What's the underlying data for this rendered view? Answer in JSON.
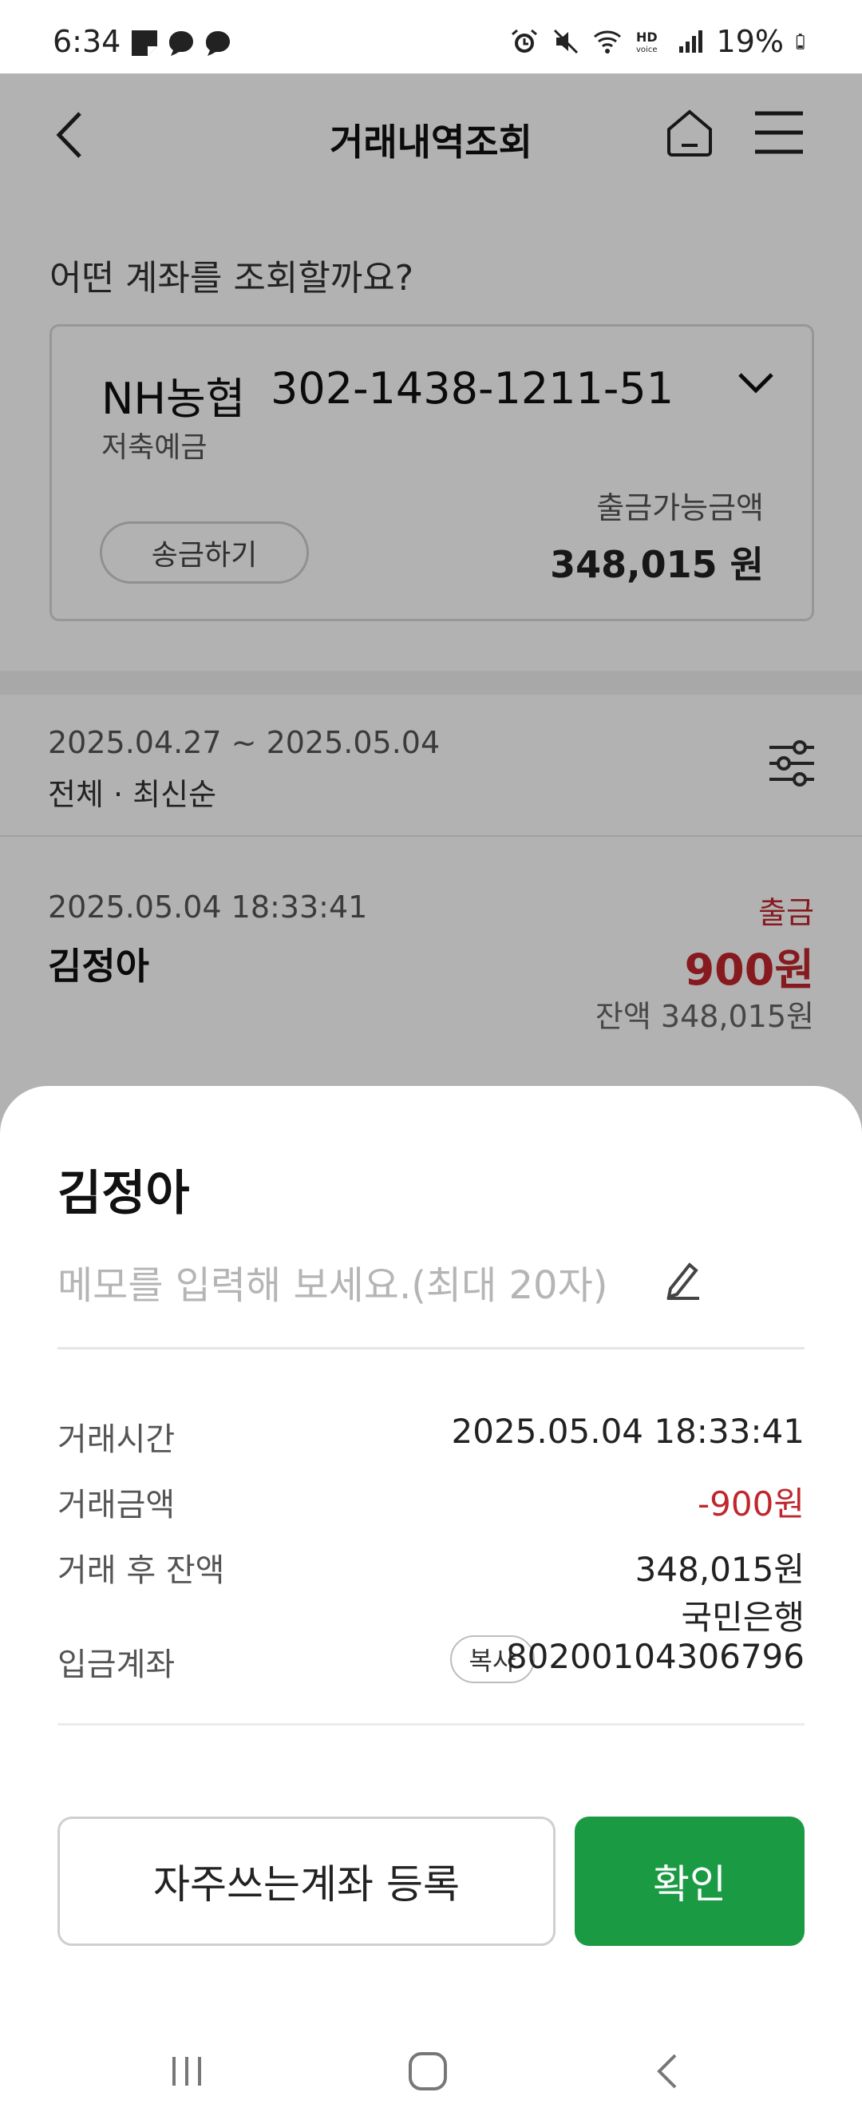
{
  "status_bar": {
    "time": "6:34",
    "battery": "19%",
    "icons": [
      "sticky-note-icon",
      "thread-icon",
      "thread-icon",
      "alarm-icon",
      "mute-icon",
      "wifi-icon",
      "hd-voice-icon",
      "signal-icon",
      "battery-icon"
    ]
  },
  "header": {
    "title": "거래내역조회",
    "icons": [
      "back-icon",
      "home-icon",
      "menu-icon"
    ]
  },
  "account": {
    "question": "어떤 계좌를 조회할까요?",
    "bank": "NH농협",
    "number": "302-1438-1211-51",
    "type": "저축예금",
    "send_label": "송금하기",
    "available_label": "출금가능금액",
    "available_amount": "348,015 원"
  },
  "filter": {
    "range": "2025.04.27 ~ 2025.05.04",
    "description": "전체 · 최신순",
    "icon": "filter-sliders-icon"
  },
  "transaction": {
    "datetime": "2025.05.04 18:33:41",
    "name": "김정아",
    "type": "출금",
    "amount": "900원",
    "balance": "잔액 348,015원"
  },
  "sheet": {
    "name": "김정아",
    "memo_placeholder": "메모를 입력해 보세요.(최대 20자)",
    "rows": [
      {
        "label": "거래시간",
        "value": "2025.05.04 18:33:41"
      },
      {
        "label": "거래금액",
        "value": "-900원"
      },
      {
        "label": "거래 후 잔액",
        "value": "348,015원"
      },
      {
        "label": "입금계좌",
        "bank": "국민은행",
        "value": "80200104306796"
      }
    ],
    "copy_label": "복사",
    "fav_button": "자주쓰는계좌 등록",
    "ok_button": "확인"
  },
  "colors": {
    "withdraw": "#c0262d",
    "confirm": "#1a9a43"
  },
  "nav_bar": [
    "recent-apps-icon",
    "home-nav-icon",
    "back-nav-icon"
  ]
}
